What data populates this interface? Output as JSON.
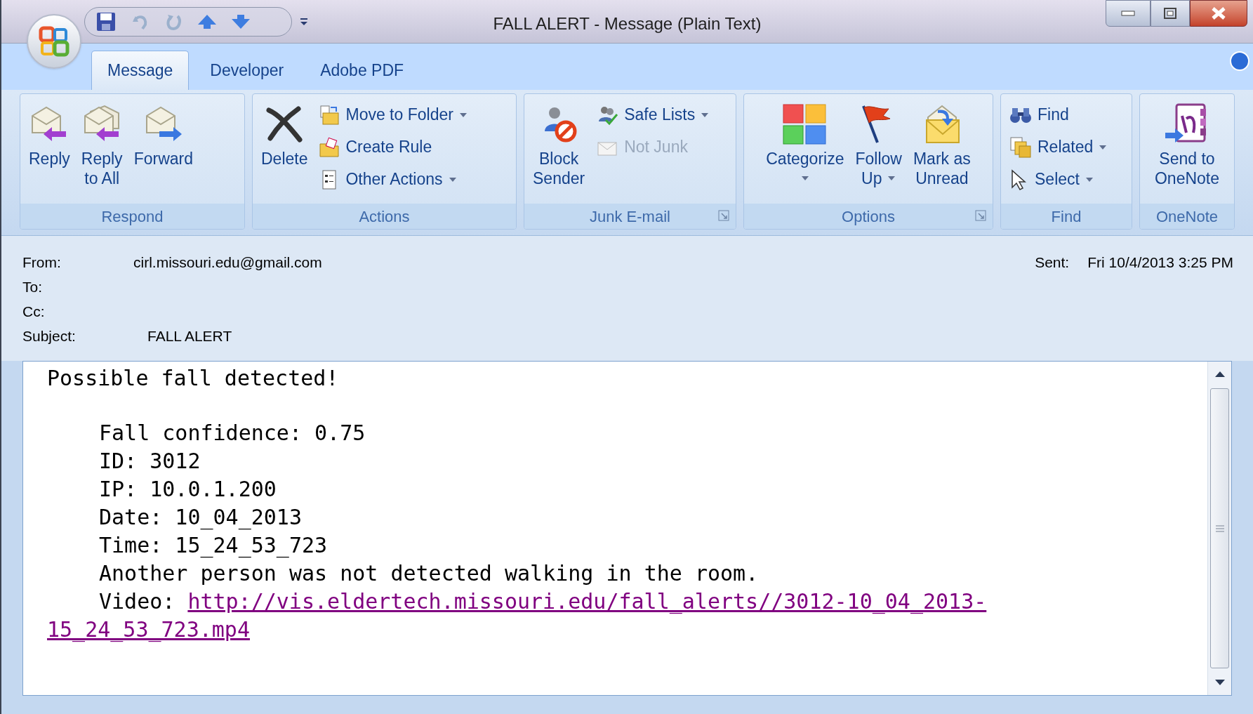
{
  "window": {
    "title": "FALL ALERT - Message (Plain Text)"
  },
  "tabs": [
    {
      "label": "Message",
      "selected": true
    },
    {
      "label": "Developer",
      "selected": false
    },
    {
      "label": "Adobe PDF",
      "selected": false
    }
  ],
  "ribbon": [
    {
      "label": "Respond",
      "launcher": false,
      "items": [
        {
          "kind": "large",
          "lines": [
            "Reply"
          ],
          "dropdown": false,
          "disabled": false
        },
        {
          "kind": "large",
          "lines": [
            "Reply",
            "to All"
          ],
          "dropdown": false,
          "disabled": false
        },
        {
          "kind": "large",
          "lines": [
            "Forward"
          ],
          "dropdown": false,
          "disabled": false
        }
      ]
    },
    {
      "label": "Actions",
      "launcher": false,
      "items": [
        {
          "kind": "large",
          "lines": [
            "Delete"
          ],
          "dropdown": false,
          "disabled": false
        },
        {
          "kind": "small",
          "lines": [
            "Move to Folder"
          ],
          "dropdown": true,
          "disabled": false
        },
        {
          "kind": "small",
          "lines": [
            "Create Rule"
          ],
          "dropdown": false,
          "disabled": false
        },
        {
          "kind": "small",
          "lines": [
            "Other Actions"
          ],
          "dropdown": true,
          "disabled": false
        }
      ]
    },
    {
      "label": "Junk E-mail",
      "launcher": true,
      "items": [
        {
          "kind": "large",
          "lines": [
            "Block",
            "Sender"
          ],
          "dropdown": false,
          "disabled": false
        },
        {
          "kind": "small",
          "lines": [
            "Safe Lists"
          ],
          "dropdown": true,
          "disabled": false
        },
        {
          "kind": "small",
          "lines": [
            "Not Junk"
          ],
          "dropdown": false,
          "disabled": true
        }
      ]
    },
    {
      "label": "Options",
      "launcher": true,
      "items": [
        {
          "kind": "large",
          "lines": [
            "Categorize"
          ],
          "dropdown": true,
          "disabled": false
        },
        {
          "kind": "large",
          "lines": [
            "Follow",
            "Up"
          ],
          "dropdown": true,
          "disabled": false
        },
        {
          "kind": "large",
          "lines": [
            "Mark as",
            "Unread"
          ],
          "dropdown": false,
          "disabled": false
        }
      ]
    },
    {
      "label": "Find",
      "launcher": false,
      "items": [
        {
          "kind": "small",
          "lines": [
            "Find"
          ],
          "dropdown": false,
          "disabled": false
        },
        {
          "kind": "small",
          "lines": [
            "Related"
          ],
          "dropdown": true,
          "disabled": false
        },
        {
          "kind": "small",
          "lines": [
            "Select"
          ],
          "dropdown": true,
          "disabled": false
        }
      ]
    },
    {
      "label": "OneNote",
      "launcher": false,
      "items": [
        {
          "kind": "large",
          "lines": [
            "Send to",
            "OneNote"
          ],
          "dropdown": false,
          "disabled": false
        }
      ]
    }
  ],
  "header": {
    "fields": [
      {
        "label": "From:",
        "value": "cirl.missouri.edu@gmail.com"
      },
      {
        "label": "To:"
      },
      {
        "label": "Cc:"
      },
      {
        "label": "Subject:",
        "value": "FALL ALERT"
      }
    ],
    "sent": {
      "label": "Sent:",
      "value": "Fri 10/4/2013 3:25 PM"
    }
  },
  "body": {
    "heading": "Possible fall detected!",
    "details": [
      {
        "text": "Fall confidence: 0.75"
      },
      {
        "text": "ID: 3012"
      },
      {
        "text": "IP: 10.0.1.200"
      },
      {
        "text": "Date: 10_04_2013"
      },
      {
        "text": "Time: 15_24_53_723"
      },
      {
        "text": "Another person was not detected walking in the room."
      },
      {
        "text": "Video:",
        "link": "http://vis.eldertech.missouri.edu/fall_alerts//3012-10_04_2013-"
      }
    ],
    "link_continuation": "15_24_53_723.mp4"
  }
}
